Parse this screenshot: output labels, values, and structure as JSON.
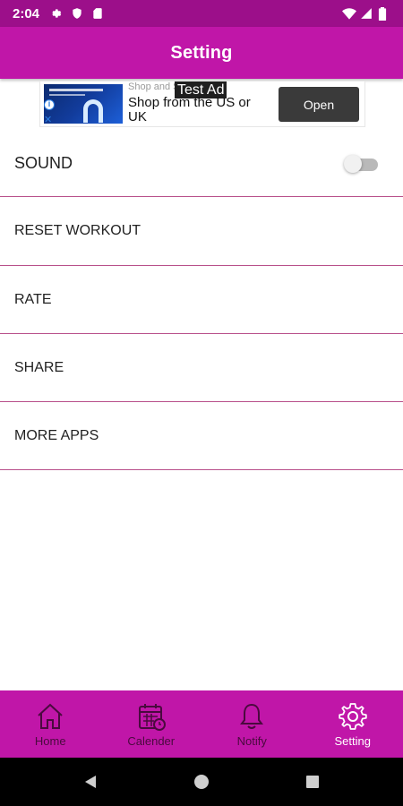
{
  "status_bar": {
    "time": "2:04"
  },
  "app_bar": {
    "title": "Setting"
  },
  "ad": {
    "source": "Shop and S",
    "label": "Test Ad",
    "headline": "Shop from the US or UK",
    "cta": "Open",
    "info_glyph": "i",
    "close_glyph": "✕"
  },
  "settings": {
    "items": [
      {
        "label": "SOUND",
        "has_toggle": true,
        "toggle_on": false
      },
      {
        "label": "RESET WORKOUT"
      },
      {
        "label": "RATE"
      },
      {
        "label": "SHARE"
      },
      {
        "label": "MORE APPS"
      }
    ]
  },
  "bottom_nav": {
    "items": [
      {
        "label": "Home",
        "icon": "home-icon",
        "active": false
      },
      {
        "label": "Calender",
        "icon": "calendar-icon",
        "active": false
      },
      {
        "label": "Notify",
        "icon": "bell-icon",
        "active": false
      },
      {
        "label": "Setting",
        "icon": "gear-icon",
        "active": true
      }
    ]
  },
  "colors": {
    "status_bar": "#9c0f8a",
    "primary": "#c016a8",
    "divider": "#b84f8a",
    "nav_inactive": "#4a0a3e",
    "nav_active": "#ffffff"
  }
}
